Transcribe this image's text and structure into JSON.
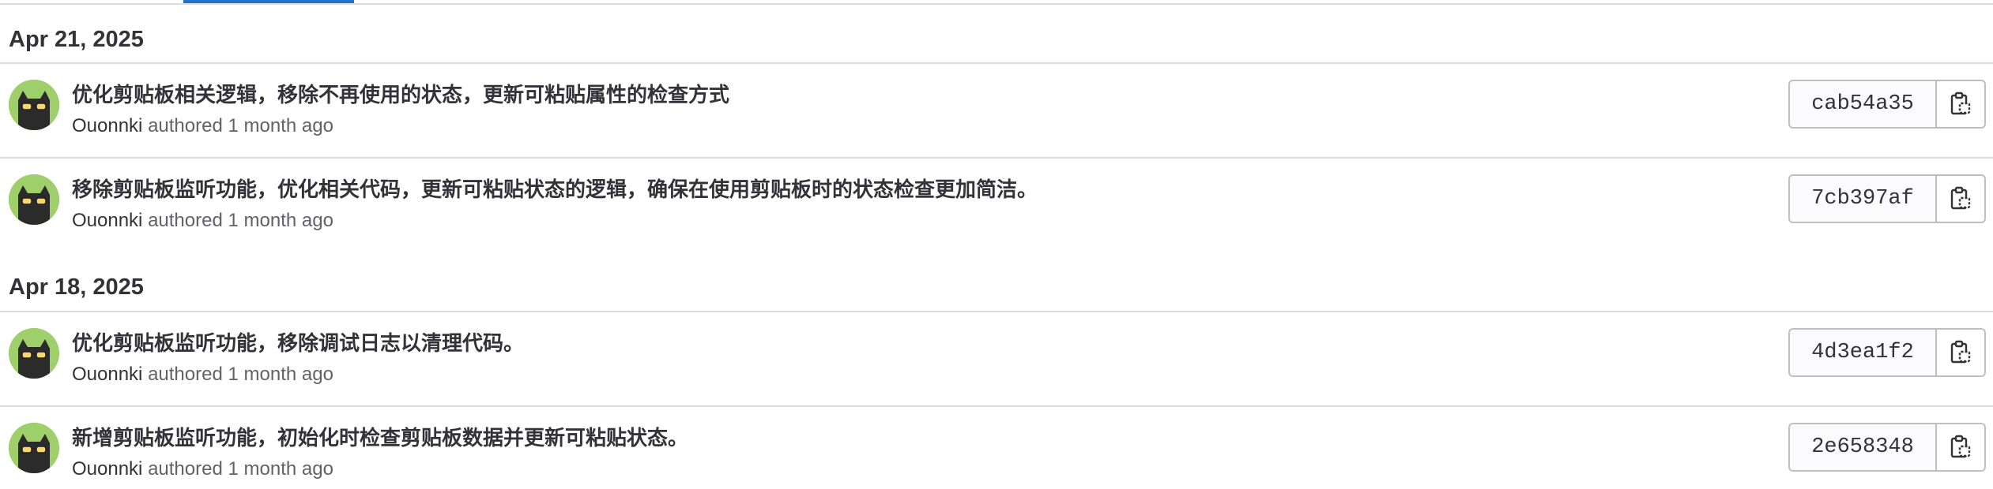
{
  "sections": [
    {
      "date": "Apr 21, 2025",
      "commits": [
        {
          "title": "优化剪贴板相关逻辑，移除不再使用的状态，更新可粘贴属性的检查方式",
          "author": "Ouonnki",
          "action": "authored",
          "time": "1 month ago",
          "sha": "cab54a35",
          "avatar_icon": "cat-sunglasses-avatar",
          "copy_icon": "clipboard-copy-icon"
        },
        {
          "title": "移除剪贴板监听功能，优化相关代码，更新可粘贴状态的逻辑，确保在使用剪贴板时的状态检查更加简洁。",
          "author": "Ouonnki",
          "action": "authored",
          "time": "1 month ago",
          "sha": "7cb397af",
          "avatar_icon": "cat-sunglasses-avatar",
          "copy_icon": "clipboard-copy-icon"
        }
      ]
    },
    {
      "date": "Apr 18, 2025",
      "commits": [
        {
          "title": "优化剪贴板监听功能，移除调试日志以清理代码。",
          "author": "Ouonnki",
          "action": "authored",
          "time": "1 month ago",
          "sha": "4d3ea1f2",
          "avatar_icon": "cat-sunglasses-avatar",
          "copy_icon": "clipboard-copy-icon"
        },
        {
          "title": "新增剪贴板监听功能，初始化时检查剪贴板数据并更新可粘贴状态。",
          "author": "Ouonnki",
          "action": "authored",
          "time": "1 month ago",
          "sha": "2e658348",
          "avatar_icon": "cat-sunglasses-avatar",
          "copy_icon": "clipboard-copy-icon"
        }
      ]
    }
  ],
  "colors": {
    "tab_active": "#1f75cb",
    "avatar_bg": "#9fcf6b",
    "text_primary": "#333238",
    "text_secondary": "#626168",
    "divider": "#dcdcde"
  }
}
